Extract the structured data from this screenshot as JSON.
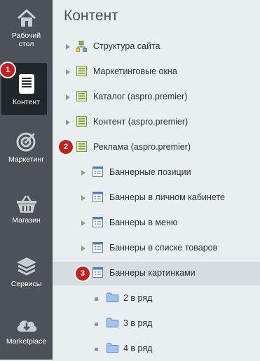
{
  "sidebar": {
    "items": [
      {
        "label1": "Рабочий",
        "label2": "стол",
        "icon": "home-icon"
      },
      {
        "label1": "Контент",
        "icon": "document-icon"
      },
      {
        "label1": "Маркетинг",
        "icon": "target-icon"
      },
      {
        "label1": "Магазин",
        "icon": "basket-icon"
      },
      {
        "label1": "Сервисы",
        "icon": "layers-icon"
      },
      {
        "label1": "Marketplace",
        "icon": "cloud-download-icon"
      }
    ]
  },
  "badges": [
    "1",
    "2",
    "3"
  ],
  "main": {
    "title": "Контент",
    "tree": [
      {
        "label": "Структура сайта",
        "icon": "site-structure-icon"
      },
      {
        "label": "Маркетинговые окна",
        "icon": "iblock-icon"
      },
      {
        "label": "Каталог (aspro.premier)",
        "icon": "iblock-icon"
      },
      {
        "label": "Контент (aspro.premier)",
        "icon": "iblock-icon"
      },
      {
        "label": "Реклама (aspro.premier)",
        "icon": "iblock-icon"
      },
      {
        "label": "Баннерные позиции",
        "icon": "list-icon"
      },
      {
        "label": "Баннеры в личном кабинете",
        "icon": "list-icon"
      },
      {
        "label": "Баннеры в меню",
        "icon": "list-icon"
      },
      {
        "label": "Баннеры в списке товаров",
        "icon": "list-icon"
      },
      {
        "label": "Баннеры картинками",
        "icon": "list-icon"
      },
      {
        "label": "2 в ряд",
        "icon": "folder-icon"
      },
      {
        "label": "3 в ряд",
        "icon": "folder-icon"
      },
      {
        "label": "4 в ряд",
        "icon": "folder-icon"
      }
    ]
  },
  "colors": {
    "sidebar": "#4c5257",
    "sidebar_active": "#22272b",
    "badge": "#c81e1e",
    "selected_row": "#d5dde1",
    "background": "#e9eef1"
  }
}
